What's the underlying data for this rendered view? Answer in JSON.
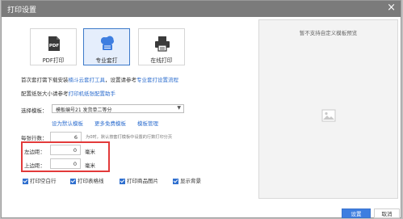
{
  "window": {
    "title": "打印设置",
    "close_glyph": "×"
  },
  "modes": [
    {
      "label": "PDF打印",
      "icon": "pdf-icon"
    },
    {
      "label": "专业套打",
      "icon": "cloud-print-icon"
    },
    {
      "label": "在线打印",
      "icon": "printer-icon"
    }
  ],
  "info": {
    "line1_prefix": "首次套打需下载安装",
    "line1_link1": "楠斗云套打工具",
    "line1_middle": "，设置请参考",
    "line1_link2": "专业套打设置流程",
    "line2_prefix": "配置纸张大小请参考",
    "line2_link": "打印机纸张配置助手"
  },
  "template": {
    "label": "选择模板：",
    "selected": "模板编号21 发货单二等分",
    "links": [
      "设为默认模板",
      "更多免费模板",
      "模板管理"
    ]
  },
  "rows_per_page": {
    "label": "每张行数：",
    "value": "6",
    "hint": "为0时，默认按套打模板中设置的行数打印分页"
  },
  "margins": {
    "left_label": "左边距：",
    "left_value": "0",
    "top_label": "上边距：",
    "top_value": "0",
    "unit": "毫米"
  },
  "checkboxes": [
    {
      "label": "打印空白行",
      "checked": true
    },
    {
      "label": "打印表格线",
      "checked": true
    },
    {
      "label": "打印商品图片",
      "checked": true
    },
    {
      "label": "显示背景",
      "checked": true
    }
  ],
  "preview": {
    "title": "暂不支持自定义模板预览"
  },
  "buttons": {
    "confirm": "设置",
    "cancel": "取消"
  },
  "colors": {
    "accent": "#3e7ee0",
    "link": "#2f6fcf",
    "highlight_border": "#e23a3a"
  }
}
